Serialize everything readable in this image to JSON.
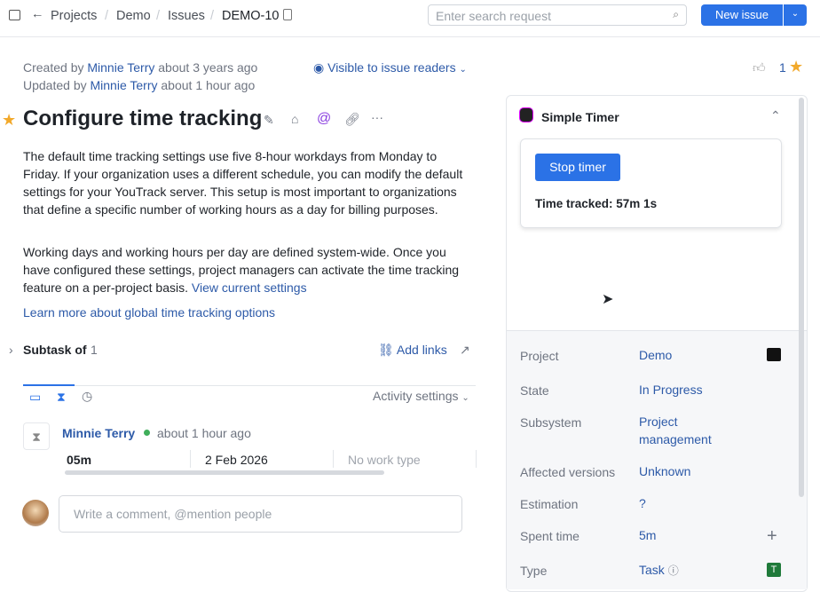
{
  "header": {
    "breadcrumbs": [
      "Projects",
      "Demo",
      "Issues",
      "DEMO-10"
    ],
    "search_placeholder": "Enter search request",
    "new_issue": "New issue"
  },
  "meta": {
    "created_prefix": "Created by",
    "created_user": "Minnie Terry",
    "created_time": "about 3 years ago",
    "updated_prefix": "Updated by",
    "updated_user": "Minnie Terry",
    "updated_time": "about 1 hour ago",
    "visibility": "Visible to issue readers",
    "star_count": "1"
  },
  "issue": {
    "title": "Configure time tracking",
    "para1": "The default time tracking settings use five 8-hour workdays from Monday to Friday. If your organization uses a different schedule, you can modify the default settings for your YouTrack server. This setup is most important to organizations that define a specific number of working hours as a day for billing purposes.",
    "para2": "Working days and working hours per day are defined system-wide. Once you have configured these settings, project managers can activate the time tracking feature on a per-project basis.",
    "para2_link": "View current settings",
    "learn_more": "Learn more about global time tracking options"
  },
  "links": {
    "subtask_label": "Subtask of",
    "subtask_count": "1",
    "add_links": "Add links"
  },
  "activity": {
    "settings": "Activity settings",
    "user": "Minnie Terry",
    "time": "about 1 hour ago",
    "duration": "05m",
    "date": "2 Feb 2026",
    "work_type": "No work type",
    "comment_placeholder": "Write a comment, @mention people"
  },
  "timer": {
    "title": "Simple Timer",
    "stop": "Stop timer",
    "tracked": "Time tracked: 57m 1s"
  },
  "fields": [
    {
      "label": "Project",
      "value": "Demo"
    },
    {
      "label": "State",
      "value": "In Progress"
    },
    {
      "label": "Subsystem",
      "value": "Project management"
    },
    {
      "label": "Affected versions",
      "value": "Unknown"
    },
    {
      "label": "Estimation",
      "value": "?"
    },
    {
      "label": "Spent time",
      "value": "5m"
    },
    {
      "label": "Type",
      "value": "Task",
      "badge": "T"
    }
  ]
}
